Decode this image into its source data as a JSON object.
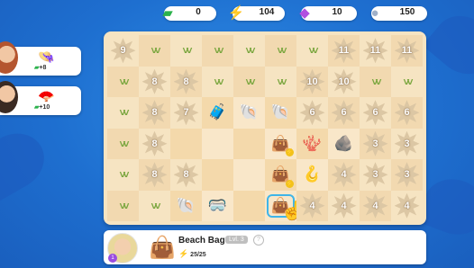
{
  "currencies": [
    {
      "name": "cash",
      "icon": "cash-icon",
      "value": "0",
      "color": "#2bb24c"
    },
    {
      "name": "energy",
      "icon": "energy-icon",
      "value": "104",
      "color": "#f2c21b"
    },
    {
      "name": "gems",
      "icon": "gem-icon",
      "value": "10",
      "color": "#b14fe0"
    },
    {
      "name": "pearls",
      "icon": "pearl-icon",
      "value": "150",
      "color": "#c9d4e4"
    }
  ],
  "customers": [
    {
      "item": "hat-icon",
      "reward": "+8"
    },
    {
      "item": "fan-icon",
      "reward": "+10"
    }
  ],
  "board": {
    "rows": [
      [
        "9",
        "g",
        "g",
        "g",
        "g",
        "g",
        "g",
        "11",
        "11",
        "11"
      ],
      [
        "g",
        "8",
        "8",
        "g",
        "g",
        "g",
        "10",
        "10",
        "g",
        "g"
      ],
      [
        "g",
        "8",
        "7",
        "trunk",
        "shell",
        "shell-big",
        "6",
        "6",
        "6",
        "6"
      ],
      [
        "g",
        "8",
        "o",
        "o",
        "o",
        "beachbag-stack",
        "coral",
        "rock",
        "3",
        "3"
      ],
      [
        "g",
        "8",
        "8",
        "o",
        "o",
        "beachbag",
        "hook",
        "4",
        "3",
        "3"
      ],
      [
        "g",
        "g",
        "seashell",
        "goggles",
        "o",
        "beachbag-sel",
        "4",
        "4",
        "4",
        "4"
      ]
    ]
  },
  "selected": {
    "name": "Beach Bag",
    "level": "Lvl. 3",
    "energy": "25/25",
    "badge": "1"
  }
}
